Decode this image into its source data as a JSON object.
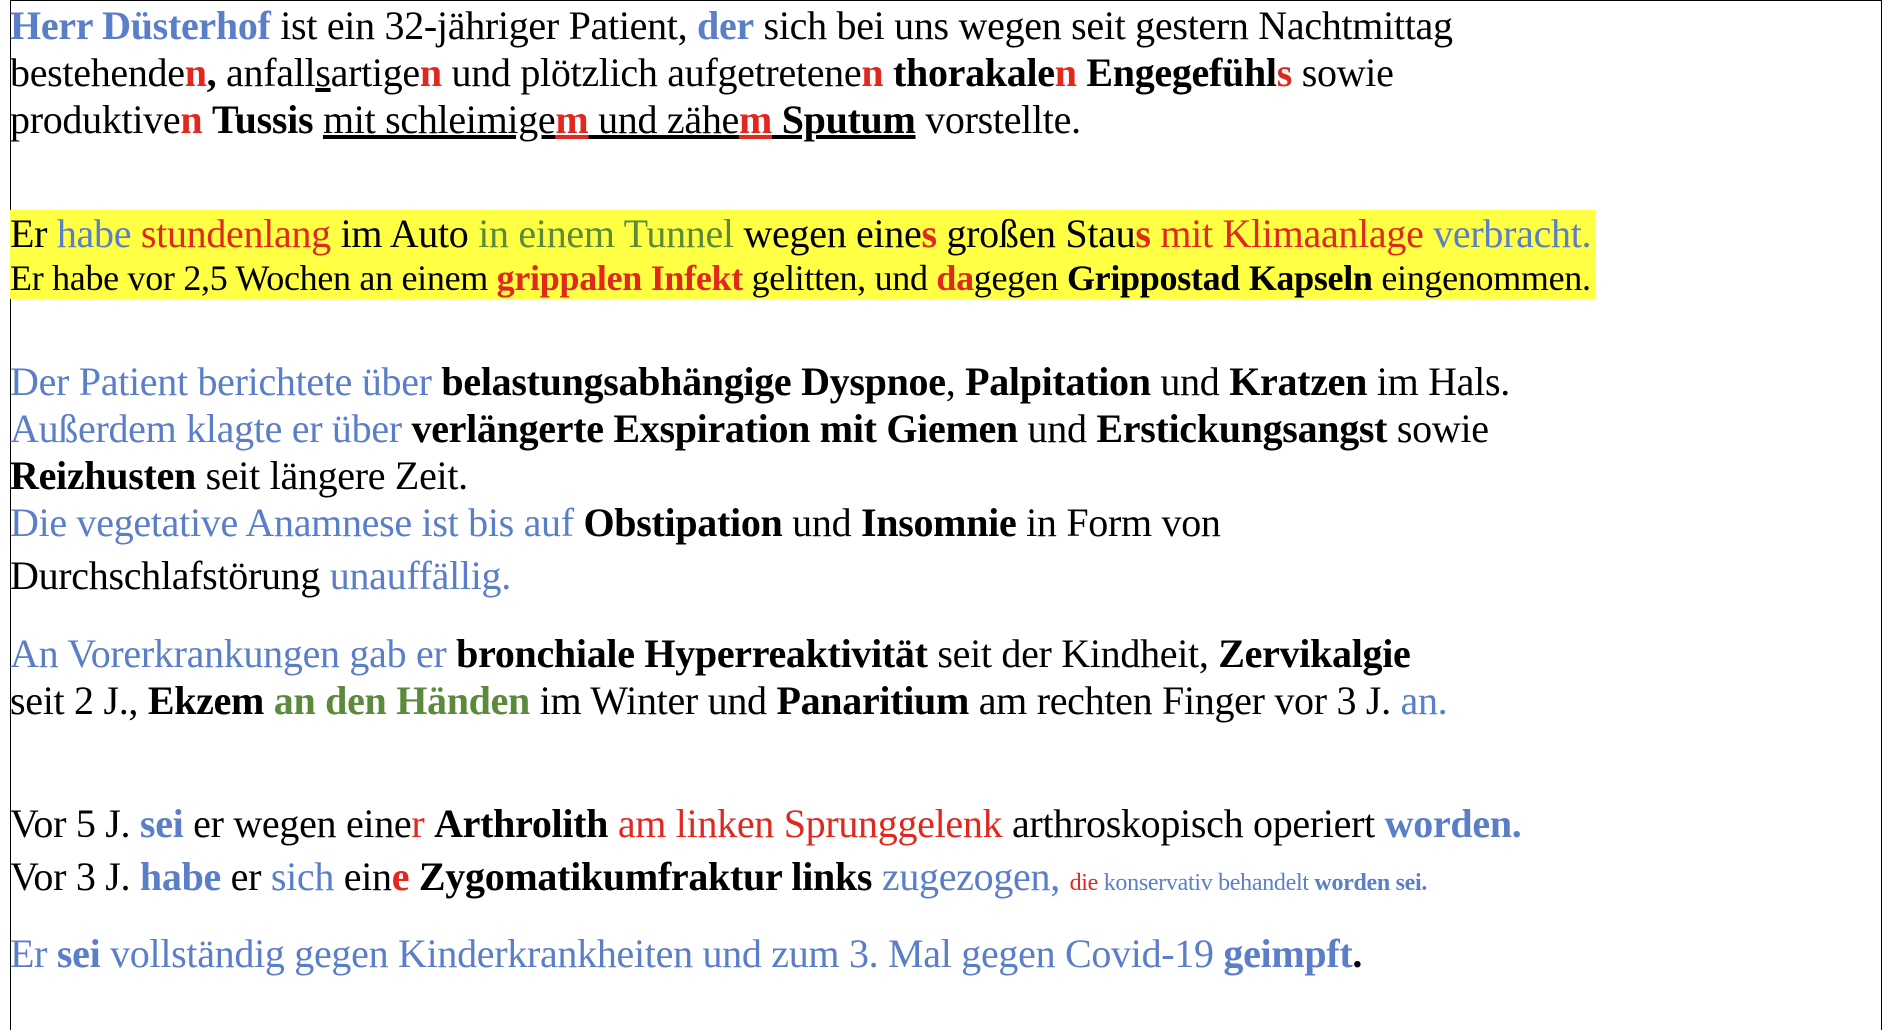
{
  "document": {
    "p1": {
      "l1": [
        "Herr Düsterhof",
        " ist ein 32-jähriger Patient, ",
        "der",
        " sich bei uns wegen seit gestern Nachtmittag"
      ],
      "l2": [
        "bestehende",
        "n",
        ",",
        " anfall",
        "s",
        "artige",
        "n",
        " und plötzlich aufgetretene",
        "n",
        " ",
        "thorakale",
        "n",
        " ",
        "Engegefühl",
        "s",
        " sowie"
      ],
      "l3": [
        "produktive",
        "n",
        " ",
        "Tussis",
        " ",
        "mit schleimige",
        "m",
        " und zähe",
        "m",
        " Sputum",
        " vorstellte."
      ]
    },
    "p2": {
      "l1": [
        "Er ",
        "habe",
        " ",
        "stundenlang",
        " im Auto ",
        "in einem Tunnel",
        " wegen eine",
        "s",
        " großen Stau",
        "s",
        " ",
        "mit Klimaanlage",
        " ",
        "verbracht."
      ],
      "l2": [
        "Er habe vor 2,5 Wochen an einem ",
        "grippalen Infekt",
        " gelitten, und ",
        "da",
        "gegen ",
        "Grippostad Kapseln",
        " eingenommen."
      ]
    },
    "p3": {
      "l1": [
        "Der Patient berichtete über",
        " ",
        "belastungsabhängige Dyspnoe",
        ", ",
        "Palpitation",
        " und ",
        "Kratzen",
        " im Hals."
      ],
      "l2": [
        "Außerdem klagte er über",
        " ",
        "verlängerte Exspiration mit Giemen",
        " und ",
        "Erstickungsangst",
        " sowie"
      ],
      "l3": [
        "Reizhusten",
        " seit längere Zeit."
      ],
      "l4": [
        "Die vegetative Anamnese ist bis auf",
        " ",
        "Obstipation",
        " und ",
        "Insomnie",
        " in Form von"
      ],
      "l5": [
        "Durchschlafstörung",
        " ",
        "unauffällig."
      ]
    },
    "p4": {
      "l1": [
        "An Vorerkrankungen gab er",
        " ",
        "bronchiale Hyperreaktivität",
        " seit der Kindheit, ",
        "Zervikalgie"
      ],
      "l2": [
        "seit 2 J., ",
        "Ekzem",
        " ",
        "an den Händen",
        " im Winter und ",
        "Panaritium",
        " am rechten Finger vor 3 J. ",
        "an."
      ]
    },
    "p5": {
      "l1": [
        "Vor 5 J. ",
        "sei",
        " er wegen eine",
        "r",
        " ",
        "Arthrolith",
        " ",
        "am linken Sprunggelenk",
        " arthroskopisch operiert ",
        "worden."
      ],
      "l2": [
        "Vor 3 J. ",
        "habe",
        " er ",
        "sich",
        " ein",
        "e",
        " ",
        "Zygomatikumfraktur links",
        " ",
        "zugezogen",
        ",",
        " ",
        "die",
        " ",
        "konservativ behandelt",
        " ",
        "worden sei."
      ]
    },
    "p6": {
      "l1": [
        "Er ",
        "sei",
        " vollständig gegen Kinderkrankheiten und zum 3. Mal gegen Covid-19 ",
        "geimpft",
        "."
      ]
    }
  },
  "colors": {
    "blue": "#5b7ec9",
    "red": "#e0281e",
    "green": "#5a8a3a",
    "highlight": "#ffff44"
  }
}
